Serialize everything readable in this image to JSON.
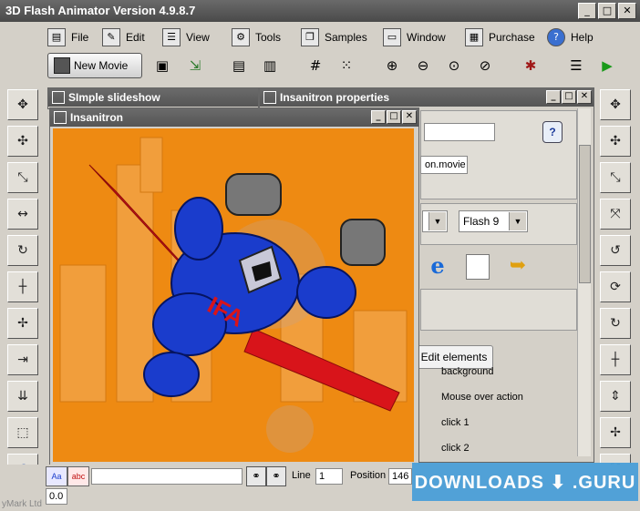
{
  "app": {
    "title": "3D Flash Animator Version 4.9.8.7",
    "win_controls": [
      "_",
      "□",
      "✕"
    ]
  },
  "menu": [
    {
      "label": "File",
      "icon": "file-icon",
      "glyph": "▤"
    },
    {
      "label": "Edit",
      "icon": "edit-icon",
      "glyph": "✎"
    },
    {
      "label": "View",
      "icon": "view-icon",
      "glyph": "☰"
    },
    {
      "label": "Tools",
      "icon": "gear-icon",
      "glyph": "⚙"
    },
    {
      "label": "Samples",
      "icon": "samples-icon",
      "glyph": "❐"
    },
    {
      "label": "Window",
      "icon": "window-icon",
      "glyph": "▭"
    },
    {
      "label": "Purchase",
      "icon": "cart-icon",
      "glyph": "▦"
    },
    {
      "label": "Help",
      "icon": "help-icon",
      "glyph": "?"
    }
  ],
  "toolbar": {
    "new_movie": "New Movie"
  },
  "windows": {
    "slideshow": {
      "title": "SImple slideshow"
    },
    "properties": {
      "title": "Insanitron properties"
    },
    "stage": {
      "title": "Insanitron"
    }
  },
  "properties": {
    "movie_file": "on.movie",
    "flash_version": "Flash 9",
    "edit_elements": "Edit elements",
    "elements": [
      "background",
      "Mouse over action",
      "click 1",
      "click 2"
    ]
  },
  "status": {
    "line_label": "Line",
    "line_value": "1",
    "position_label": "Position",
    "position_value": "146",
    "bottom_value": "0.0",
    "mark_text": "yMark Ltd"
  },
  "watermark": "DOWNLOADS ⬇ .GURU",
  "colors": {
    "stage_bg": "#ee8a12",
    "robot_blue": "#1a3ccc",
    "wings_red": "#d8141a"
  }
}
